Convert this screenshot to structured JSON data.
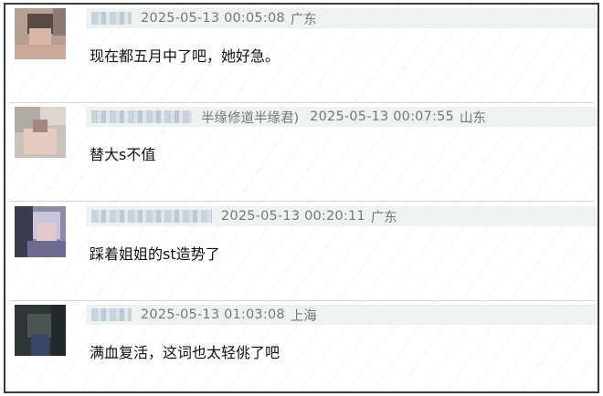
{
  "comments": [
    {
      "user_suffix": "",
      "timestamp": "2025-05-13 00:05:08",
      "location": "广东",
      "text": "现在都五月中了吧，她好急。"
    },
    {
      "user_suffix": "半缘修道半缘君)",
      "timestamp": "2025-05-13 00:07:55",
      "location": "山东",
      "text": "替大s不值"
    },
    {
      "user_suffix": "",
      "timestamp": "2025-05-13 00:20:11",
      "location": "广东",
      "text": "踩着姐姐的st造势了"
    },
    {
      "user_suffix": "",
      "timestamp": "2025-05-13 01:03:08",
      "location": "上海",
      "text": "满血复活，这词也太轻佻了吧"
    }
  ],
  "colors": {
    "meta_bg": "#eef3f1",
    "meta_text": "#777777",
    "body_text": "#111111",
    "frame_border": "#3a3a3a"
  }
}
